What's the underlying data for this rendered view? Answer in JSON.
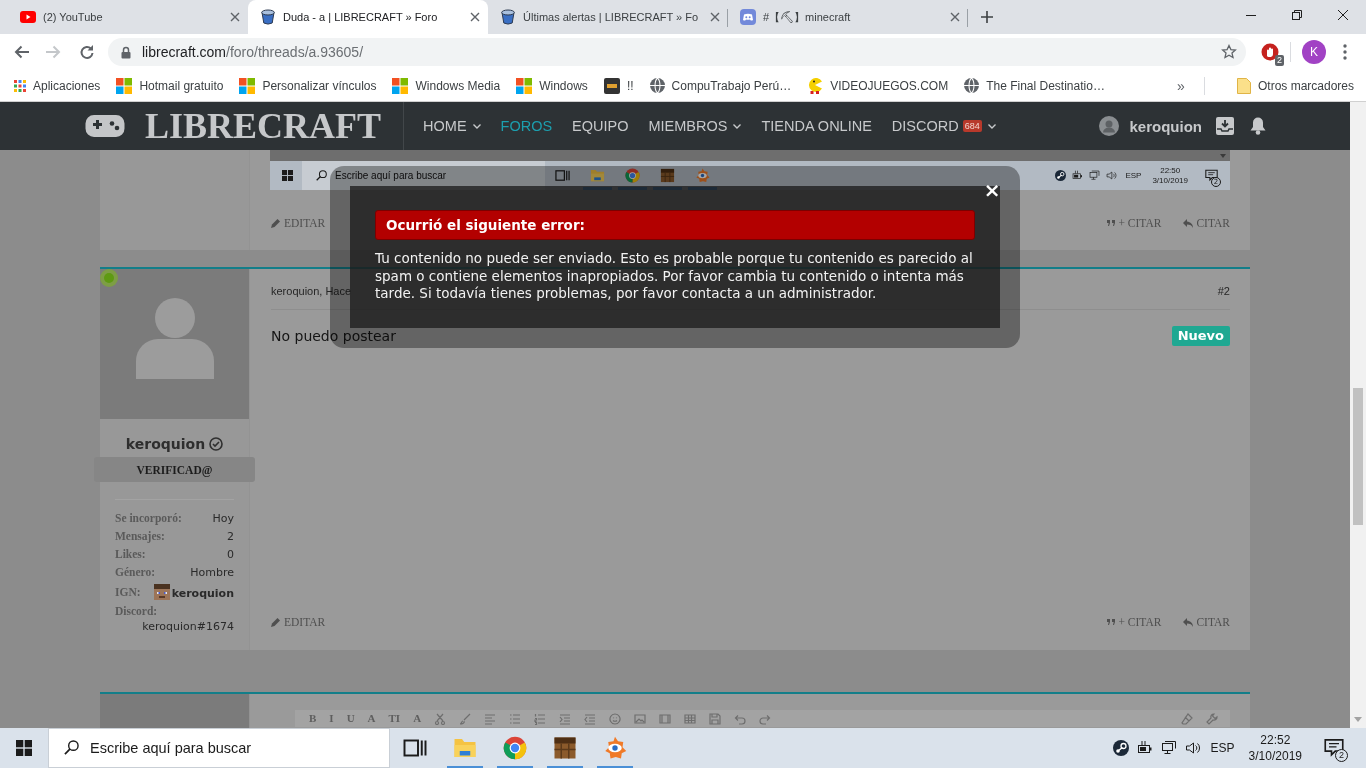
{
  "browser": {
    "tabs": [
      {
        "kind": "video",
        "title": "(2) YouTube",
        "selected": false
      },
      {
        "kind": "bucket",
        "title": "Duda - a | LIBRECRAFT » Foro",
        "selected": true
      },
      {
        "kind": "bucket",
        "title": "Últimas alertas | LIBRECRAFT » Fo",
        "selected": false
      },
      {
        "kind": "chat",
        "title": "#【⛏】minecraft",
        "selected": false
      }
    ],
    "back_disabled": false,
    "forward_disabled": true,
    "url_host": "librecraft.com",
    "url_path": "/foro/threads/a.93605/",
    "extension_badge": "2",
    "profile_initial": "K",
    "bookmarks": [
      {
        "kind": "apps",
        "label": "Aplicaciones"
      },
      {
        "kind": "windows",
        "label": "Hotmail gratuito"
      },
      {
        "kind": "windows",
        "label": "Personalizar vínculos"
      },
      {
        "kind": "windows",
        "label": "Windows Media"
      },
      {
        "kind": "windows",
        "label": "Windows"
      },
      {
        "kind": "tile",
        "label": "!!"
      },
      {
        "kind": "globe",
        "label": "CompuTrabajo Perú…"
      },
      {
        "kind": "cartoon",
        "label": "VIDEOJUEGOS.COM"
      },
      {
        "kind": "globe",
        "label": "The Final Destinatio…"
      }
    ],
    "bookmarks_overflow": "»",
    "other_bookmarks": "Otros marcadores"
  },
  "site_nav": {
    "logo": "LIBRECRAFT",
    "items": [
      {
        "label": "HOME",
        "selected": false,
        "dropdown": true
      },
      {
        "label": "FOROS",
        "selected": true,
        "dropdown": false
      },
      {
        "label": "EQUIPO",
        "selected": false,
        "dropdown": false
      },
      {
        "label": "MIEMBROS",
        "selected": false,
        "dropdown": true
      },
      {
        "label": "TIENDA ONLINE",
        "selected": false,
        "dropdown": false
      },
      {
        "label": "DISCORD",
        "selected": false,
        "dropdown": true,
        "badge": "684"
      }
    ],
    "user": "keroquion"
  },
  "previous_post": {
    "screenshot": {
      "placeholder": "Escribe aquí para buscar",
      "apps": [
        {
          "kind": "taskview",
          "running": false
        },
        {
          "kind": "folder",
          "running": true
        },
        {
          "kind": "browser",
          "running": true
        },
        {
          "kind": "crate",
          "running": true
        },
        {
          "kind": "eye",
          "running": true
        }
      ],
      "lang": "ESP",
      "time": "22:50",
      "date": "3/10/2019",
      "notifications": "2"
    },
    "edit": "EDITAR",
    "multiquote": "+ CITAR",
    "quote": "CITAR"
  },
  "post": {
    "online": true,
    "author": "keroquion",
    "verified": true,
    "user_title": "VERIFICAD@",
    "stats": [
      {
        "kind": "plain",
        "label": "Se incorporó:",
        "value": "Hoy"
      },
      {
        "kind": "plain",
        "label": "Mensajes:",
        "value": "2"
      },
      {
        "kind": "plain",
        "label": "Likes:",
        "value": "0"
      },
      {
        "kind": "plain",
        "label": "Género:",
        "value": "Hombre"
      },
      {
        "kind": "ign",
        "label": "IGN:",
        "value": "keroquion"
      },
      {
        "kind": "stacked",
        "label": "Discord:",
        "value": "keroquion#1674"
      }
    ],
    "meta": "keroquion, Hace",
    "number": "#2",
    "body": "No puedo postear",
    "badge": "Nuevo",
    "edit": "EDITAR",
    "multiquote": "+ CITAR",
    "quote": "CITAR"
  },
  "next_post": {
    "toolbar_letters": [
      "B",
      "I",
      "U",
      "A",
      "TI",
      "A"
    ]
  },
  "modal": {
    "close": "×",
    "title": "Ocurrió el siguiente error:",
    "message": "Tu contenido no puede ser enviado. Esto es probable porque tu contenido es parecido al spam o contiene elementos inapropiados. Por favor cambia tu contenido o intenta más tarde. Si todavía tienes problemas, por favor contacta a un administrador."
  },
  "taskbar": {
    "placeholder": "Escribe aquí para buscar",
    "apps": [
      {
        "kind": "taskview",
        "running": false
      },
      {
        "kind": "folder",
        "running": true
      },
      {
        "kind": "browser",
        "running": true
      },
      {
        "kind": "crate",
        "running": true
      },
      {
        "kind": "eye",
        "running": true
      }
    ],
    "lang": "ESP",
    "time": "22:52",
    "date": "3/10/2019",
    "notifications": "2"
  }
}
